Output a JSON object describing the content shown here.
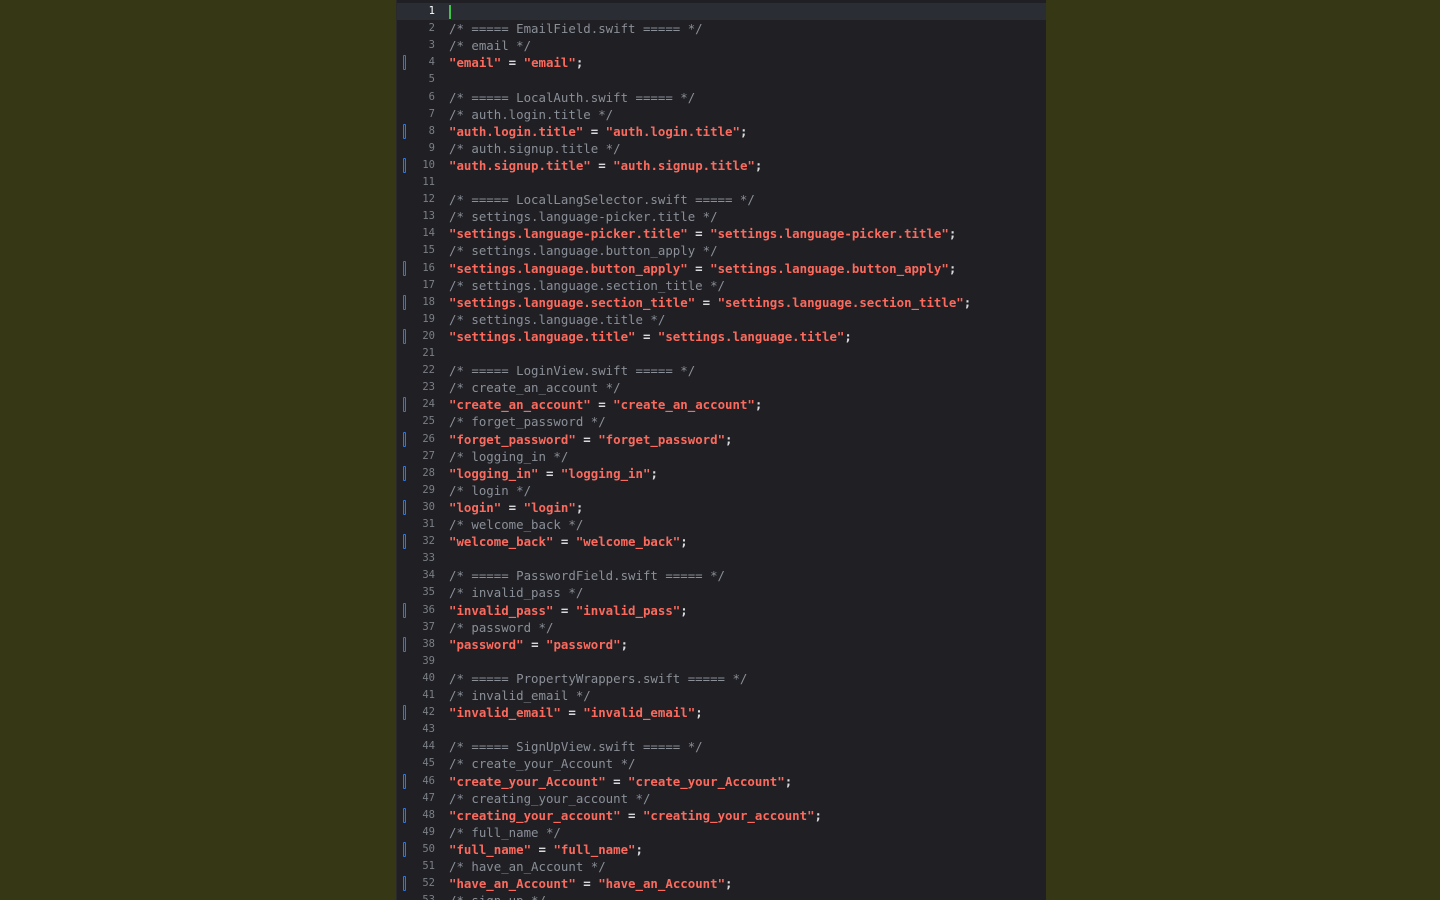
{
  "editor": {
    "file_type": "Localizable.strings",
    "cursor_line": 1,
    "lines": [
      {
        "n": "1",
        "text": "",
        "kind": "blank",
        "changed": false,
        "current": true
      },
      {
        "n": "2",
        "text": "/* ===== EmailField.swift ===== */",
        "kind": "comment",
        "changed": false
      },
      {
        "n": "3",
        "text": "/* email */",
        "kind": "comment",
        "changed": false
      },
      {
        "n": "4",
        "key": "email",
        "value": "email",
        "kind": "entry",
        "changed": true
      },
      {
        "n": "5",
        "text": "",
        "kind": "blank",
        "changed": false
      },
      {
        "n": "6",
        "text": "/* ===== LocalAuth.swift ===== */",
        "kind": "comment",
        "changed": false
      },
      {
        "n": "7",
        "text": "/* auth.login.title */",
        "kind": "comment",
        "changed": false
      },
      {
        "n": "8",
        "key": "auth.login.title",
        "value": "auth.login.title",
        "kind": "entry",
        "changed": true
      },
      {
        "n": "9",
        "text": "/* auth.signup.title */",
        "kind": "comment",
        "changed": false
      },
      {
        "n": "10",
        "key": "auth.signup.title",
        "value": "auth.signup.title",
        "kind": "entry",
        "changed": true
      },
      {
        "n": "11",
        "text": "",
        "kind": "blank",
        "changed": false
      },
      {
        "n": "12",
        "text": "/* ===== LocalLangSelector.swift ===== */",
        "kind": "comment",
        "changed": false
      },
      {
        "n": "13",
        "text": "/* settings.language-picker.title */",
        "kind": "comment",
        "changed": false
      },
      {
        "n": "14",
        "key": "settings.language-picker.title",
        "value": "settings.language-picker.title",
        "kind": "entry",
        "changed": false
      },
      {
        "n": "15",
        "text": "/* settings.language.button_apply */",
        "kind": "comment",
        "changed": false
      },
      {
        "n": "16",
        "key": "settings.language.button_apply",
        "value": "settings.language.button_apply",
        "kind": "entry",
        "changed": true
      },
      {
        "n": "17",
        "text": "/* settings.language.section_title */",
        "kind": "comment",
        "changed": false
      },
      {
        "n": "18",
        "key": "settings.language.section_title",
        "value": "settings.language.section_title",
        "kind": "entry",
        "changed": true
      },
      {
        "n": "19",
        "text": "/* settings.language.title */",
        "kind": "comment",
        "changed": false
      },
      {
        "n": "20",
        "key": "settings.language.title",
        "value": "settings.language.title",
        "kind": "entry",
        "changed": true
      },
      {
        "n": "21",
        "text": "",
        "kind": "blank",
        "changed": false
      },
      {
        "n": "22",
        "text": "/* ===== LoginView.swift ===== */",
        "kind": "comment",
        "changed": false
      },
      {
        "n": "23",
        "text": "/* create_an_account */",
        "kind": "comment",
        "changed": false
      },
      {
        "n": "24",
        "key": "create_an_account",
        "value": "create_an_account",
        "kind": "entry",
        "changed": true
      },
      {
        "n": "25",
        "text": "/* forget_password */",
        "kind": "comment",
        "changed": false
      },
      {
        "n": "26",
        "key": "forget_password",
        "value": "forget_password",
        "kind": "entry",
        "changed": true
      },
      {
        "n": "27",
        "text": "/* logging_in */",
        "kind": "comment",
        "changed": false
      },
      {
        "n": "28",
        "key": "logging_in",
        "value": "logging_in",
        "kind": "entry",
        "changed": true
      },
      {
        "n": "29",
        "text": "/* login */",
        "kind": "comment",
        "changed": false
      },
      {
        "n": "30",
        "key": "login",
        "value": "login",
        "kind": "entry",
        "changed": true
      },
      {
        "n": "31",
        "text": "/* welcome_back */",
        "kind": "comment",
        "changed": false
      },
      {
        "n": "32",
        "key": "welcome_back",
        "value": "welcome_back",
        "kind": "entry",
        "changed": true
      },
      {
        "n": "33",
        "text": "",
        "kind": "blank",
        "changed": false
      },
      {
        "n": "34",
        "text": "/* ===== PasswordField.swift ===== */",
        "kind": "comment",
        "changed": false
      },
      {
        "n": "35",
        "text": "/* invalid_pass */",
        "kind": "comment",
        "changed": false
      },
      {
        "n": "36",
        "key": "invalid_pass",
        "value": "invalid_pass",
        "kind": "entry",
        "changed": true
      },
      {
        "n": "37",
        "text": "/* password */",
        "kind": "comment",
        "changed": false
      },
      {
        "n": "38",
        "key": "password",
        "value": "password",
        "kind": "entry",
        "changed": true
      },
      {
        "n": "39",
        "text": "",
        "kind": "blank",
        "changed": false
      },
      {
        "n": "40",
        "text": "/* ===== PropertyWrappers.swift ===== */",
        "kind": "comment",
        "changed": false
      },
      {
        "n": "41",
        "text": "/* invalid_email */",
        "kind": "comment",
        "changed": false
      },
      {
        "n": "42",
        "key": "invalid_email",
        "value": "invalid_email",
        "kind": "entry",
        "changed": true
      },
      {
        "n": "43",
        "text": "",
        "kind": "blank",
        "changed": false
      },
      {
        "n": "44",
        "text": "/* ===== SignUpView.swift ===== */",
        "kind": "comment",
        "changed": false
      },
      {
        "n": "45",
        "text": "/* create_your_Account */",
        "kind": "comment",
        "changed": false
      },
      {
        "n": "46",
        "key": "create_your_Account",
        "value": "create_your_Account",
        "kind": "entry",
        "changed": true
      },
      {
        "n": "47",
        "text": "/* creating_your_account */",
        "kind": "comment",
        "changed": false
      },
      {
        "n": "48",
        "key": "creating_your_account",
        "value": "creating_your_account",
        "kind": "entry",
        "changed": true
      },
      {
        "n": "49",
        "text": "/* full_name */",
        "kind": "comment",
        "changed": false
      },
      {
        "n": "50",
        "key": "full_name",
        "value": "full_name",
        "kind": "entry",
        "changed": true
      },
      {
        "n": "51",
        "text": "/* have_an_Account */",
        "kind": "comment",
        "changed": false
      },
      {
        "n": "52",
        "key": "have_an_Account",
        "value": "have_an_Account",
        "kind": "entry",
        "changed": true
      },
      {
        "n": "53",
        "text": "/* sign_up */",
        "kind": "comment",
        "changed": false
      }
    ]
  },
  "colors": {
    "desktop": "#363815",
    "editor_bg": "#1f1f24",
    "string": "#fc6a5d",
    "comment": "#8a8f98",
    "change_marker": "#2f76e0",
    "cursor": "#3ec54a"
  }
}
